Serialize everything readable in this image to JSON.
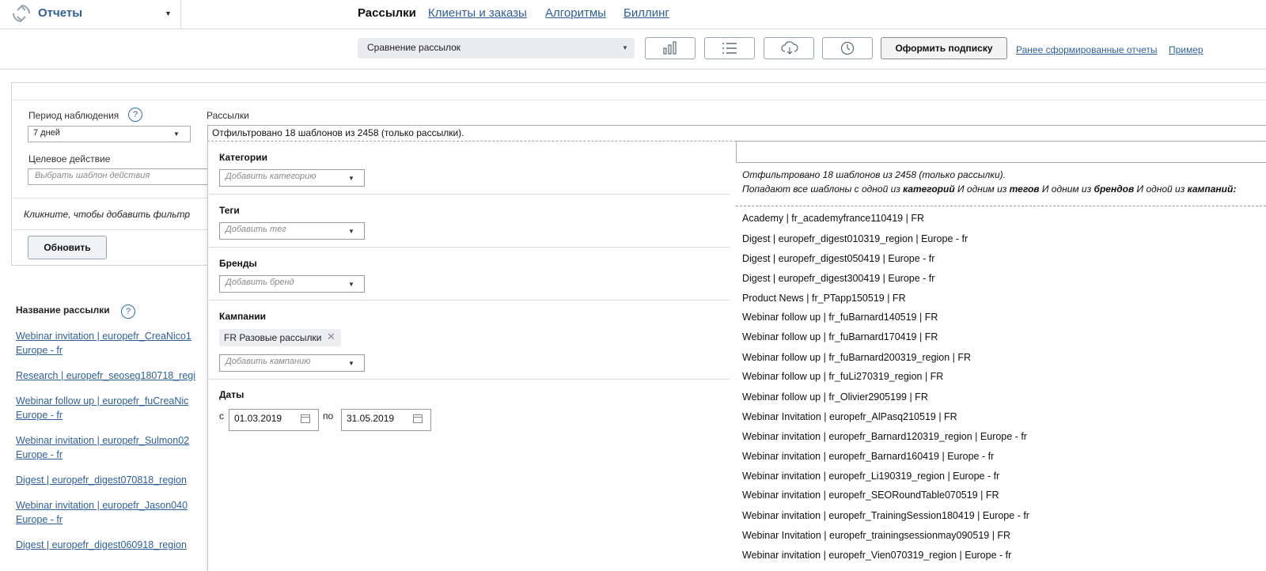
{
  "app": {
    "title": "Отчеты"
  },
  "nav": {
    "items": [
      {
        "label": "Рассылки",
        "active": true
      },
      {
        "label": "Клиенты и заказы",
        "active": false
      },
      {
        "label": "Алгоритмы",
        "active": false
      },
      {
        "label": "Биллинг",
        "active": false
      }
    ]
  },
  "toolbar": {
    "report_select": "Сравнение рассылок",
    "icons": [
      "bar-chart-icon",
      "list-icon",
      "cloud-download-icon",
      "clock-icon"
    ],
    "subscribe_label": "Оформить подписку",
    "previous_reports_link": "Ранее сформированные отчеты",
    "example_link": "Пример"
  },
  "filters": {
    "period_label": "Период наблюдения",
    "period_value": "7 дней",
    "target_action_label": "Целевое действие",
    "target_action_placeholder": "Выбрать шаблон действия",
    "add_filter_hint": "Кликните, чтобы добавить фильтр",
    "refresh_label": "Обновить",
    "mailings_label": "Рассылки",
    "mailings_summary": "Отфильтровано 18 шаблонов из 2458 (только рассылки).",
    "help_glyph": "?"
  },
  "dropdown": {
    "categories_title": "Категории",
    "categories_placeholder": "Добавить категорию",
    "tags_title": "Теги",
    "tags_placeholder": "Добавить тег",
    "brands_title": "Бренды",
    "brands_placeholder": "Добавить бренд",
    "campaigns_title": "Кампании",
    "campaign_chip": "FR Разовые рассылки",
    "campaigns_placeholder": "Добавить кампанию",
    "dates_title": "Даты",
    "date_from_prefix": "с",
    "date_from": "01.03.2019",
    "date_to_prefix": "по",
    "date_to": "31.05.2019",
    "result_line1": "Отфильтровано 18 шаблонов из 2458 (только рассылки).",
    "result_line2_parts": {
      "p1": "Попадают все шаблоны с одной из ",
      "b1": "категорий",
      "p2": " И одним из ",
      "b2": "тегов",
      "p3": " И одним из ",
      "b3": "брендов",
      "p4": " И одной из ",
      "b4": "кампаний:"
    },
    "results": [
      "Academy | fr_academyfrance110419 | FR",
      "Digest | europefr_digest010319_region | Europe - fr",
      "Digest | europefr_digest050419 | Europe - fr",
      "Digest | europefr_digest300419 | Europe - fr",
      "Product News | fr_PTapp150519 | FR",
      "Webinar follow up | fr_fuBarnard140519 | FR",
      "Webinar follow up | fr_fuBarnard170419 | FR",
      "Webinar follow up | fr_fuBarnard200319_region | FR",
      "Webinar follow up | fr_fuLi270319_region | FR",
      "Webinar follow up | fr_Olivier2905199 | FR",
      "Webinar Invitation | europefr_AlPasq210519 | FR",
      "Webinar invitation | europefr_Barnard120319_region | Europe - fr",
      "Webinar invitation | europefr_Barnard160419 | Europe - fr",
      "Webinar invitation | europefr_Li190319_region | Europe - fr",
      "Webinar invitation | europefr_SEORoundTable070519 | FR",
      "Webinar invitation | europefr_TrainingSession180419 | Europe - fr",
      "Webinar Invitation | europefr_trainingsessionmay090519 | FR",
      "Webinar invitation | europefr_Vien070319_region | Europe - fr"
    ]
  },
  "mailing_list": {
    "title": "Название рассылки",
    "links": [
      "Webinar invitation | europefr_CreaNico1",
      "Europe - fr",
      "Research | europefr_seoseg180718_regi",
      "Webinar follow up | europefr_fuCreaNic",
      "Europe - fr",
      "Webinar invitation | europefr_Sulmon02",
      "Europe - fr",
      "Digest | europefr_digest070818_region",
      "Webinar invitation | europefr_Jason040",
      "Europe - fr",
      "Digest | europefr_digest060918_region"
    ]
  }
}
